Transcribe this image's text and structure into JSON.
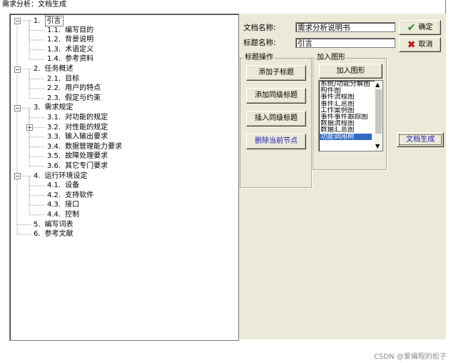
{
  "window": {
    "title": "需求分析：文档生成"
  },
  "tree": {
    "items": [
      {
        "num": "1.",
        "label": "引言",
        "level": 0,
        "expander": "minus",
        "selected": true
      },
      {
        "num": "1.1.",
        "label": "编写目的",
        "level": 1
      },
      {
        "num": "1.2.",
        "label": "背景说明",
        "level": 1
      },
      {
        "num": "1.3.",
        "label": "术语定义",
        "level": 1
      },
      {
        "num": "1.4.",
        "label": "参考资料",
        "level": 1
      },
      {
        "num": "2.",
        "label": "任务概述",
        "level": 0,
        "expander": "minus"
      },
      {
        "num": "2.1.",
        "label": "目标",
        "level": 1
      },
      {
        "num": "2.2.",
        "label": "用户的特点",
        "level": 1
      },
      {
        "num": "2.3.",
        "label": "假定与约束",
        "level": 1
      },
      {
        "num": "3.",
        "label": "需求规定",
        "level": 0,
        "expander": "minus"
      },
      {
        "num": "3.1.",
        "label": "对功能的规定",
        "level": 1
      },
      {
        "num": "3.2.",
        "label": "对性能的规定",
        "level": 1,
        "expander": "plus"
      },
      {
        "num": "3.3.",
        "label": "输入输出要求",
        "level": 1
      },
      {
        "num": "3.4.",
        "label": "数据管理能力要求",
        "level": 1
      },
      {
        "num": "3.5.",
        "label": "故障处理要求",
        "level": 1
      },
      {
        "num": "3.6.",
        "label": "其它专门要求",
        "level": 1
      },
      {
        "num": "4.",
        "label": "运行环境设定",
        "level": 0,
        "expander": "minus"
      },
      {
        "num": "4.1.",
        "label": "设备",
        "level": 1
      },
      {
        "num": "4.2.",
        "label": "支持软件",
        "level": 1
      },
      {
        "num": "4.3.",
        "label": "接口",
        "level": 1
      },
      {
        "num": "4.4.",
        "label": "控制",
        "level": 1
      },
      {
        "num": "5.",
        "label": "编写词表",
        "level": 0
      },
      {
        "num": "6.",
        "label": "参考文献",
        "level": 0
      }
    ]
  },
  "form": {
    "doc_name_label": "文档名称:",
    "doc_name_value": "需求分析说明书",
    "title_name_label": "标题名称:",
    "title_name_value": "引言",
    "ok_label": "确定",
    "cancel_label": "取消",
    "title_ops_group": "标题操作",
    "add_child": "添加子标题",
    "add_sibling": "添加同级标题",
    "insert_sibling": "插入同级标题",
    "delete_node": "删除当前节点",
    "add_figure_group": "加入图形",
    "add_figure_button": "加入图形",
    "figure_list": [
      "系统/功能分解图",
      "构件图",
      "事件流程图",
      "事件汇总图",
      "工作案例图",
      "事件事件跟踪图",
      "数据流程图",
      "数据汇总图",
      "功能调用树"
    ],
    "figure_selected": 8,
    "generate_doc": "文档生成"
  },
  "watermark": "CSDN @爱编程的松子",
  "colors": {
    "panel": "#ece9d8",
    "selection": "#316ac5",
    "ok_check": "#1a8f1a",
    "cancel_x": "#c01010",
    "delete_text": "#1a1ab0"
  }
}
